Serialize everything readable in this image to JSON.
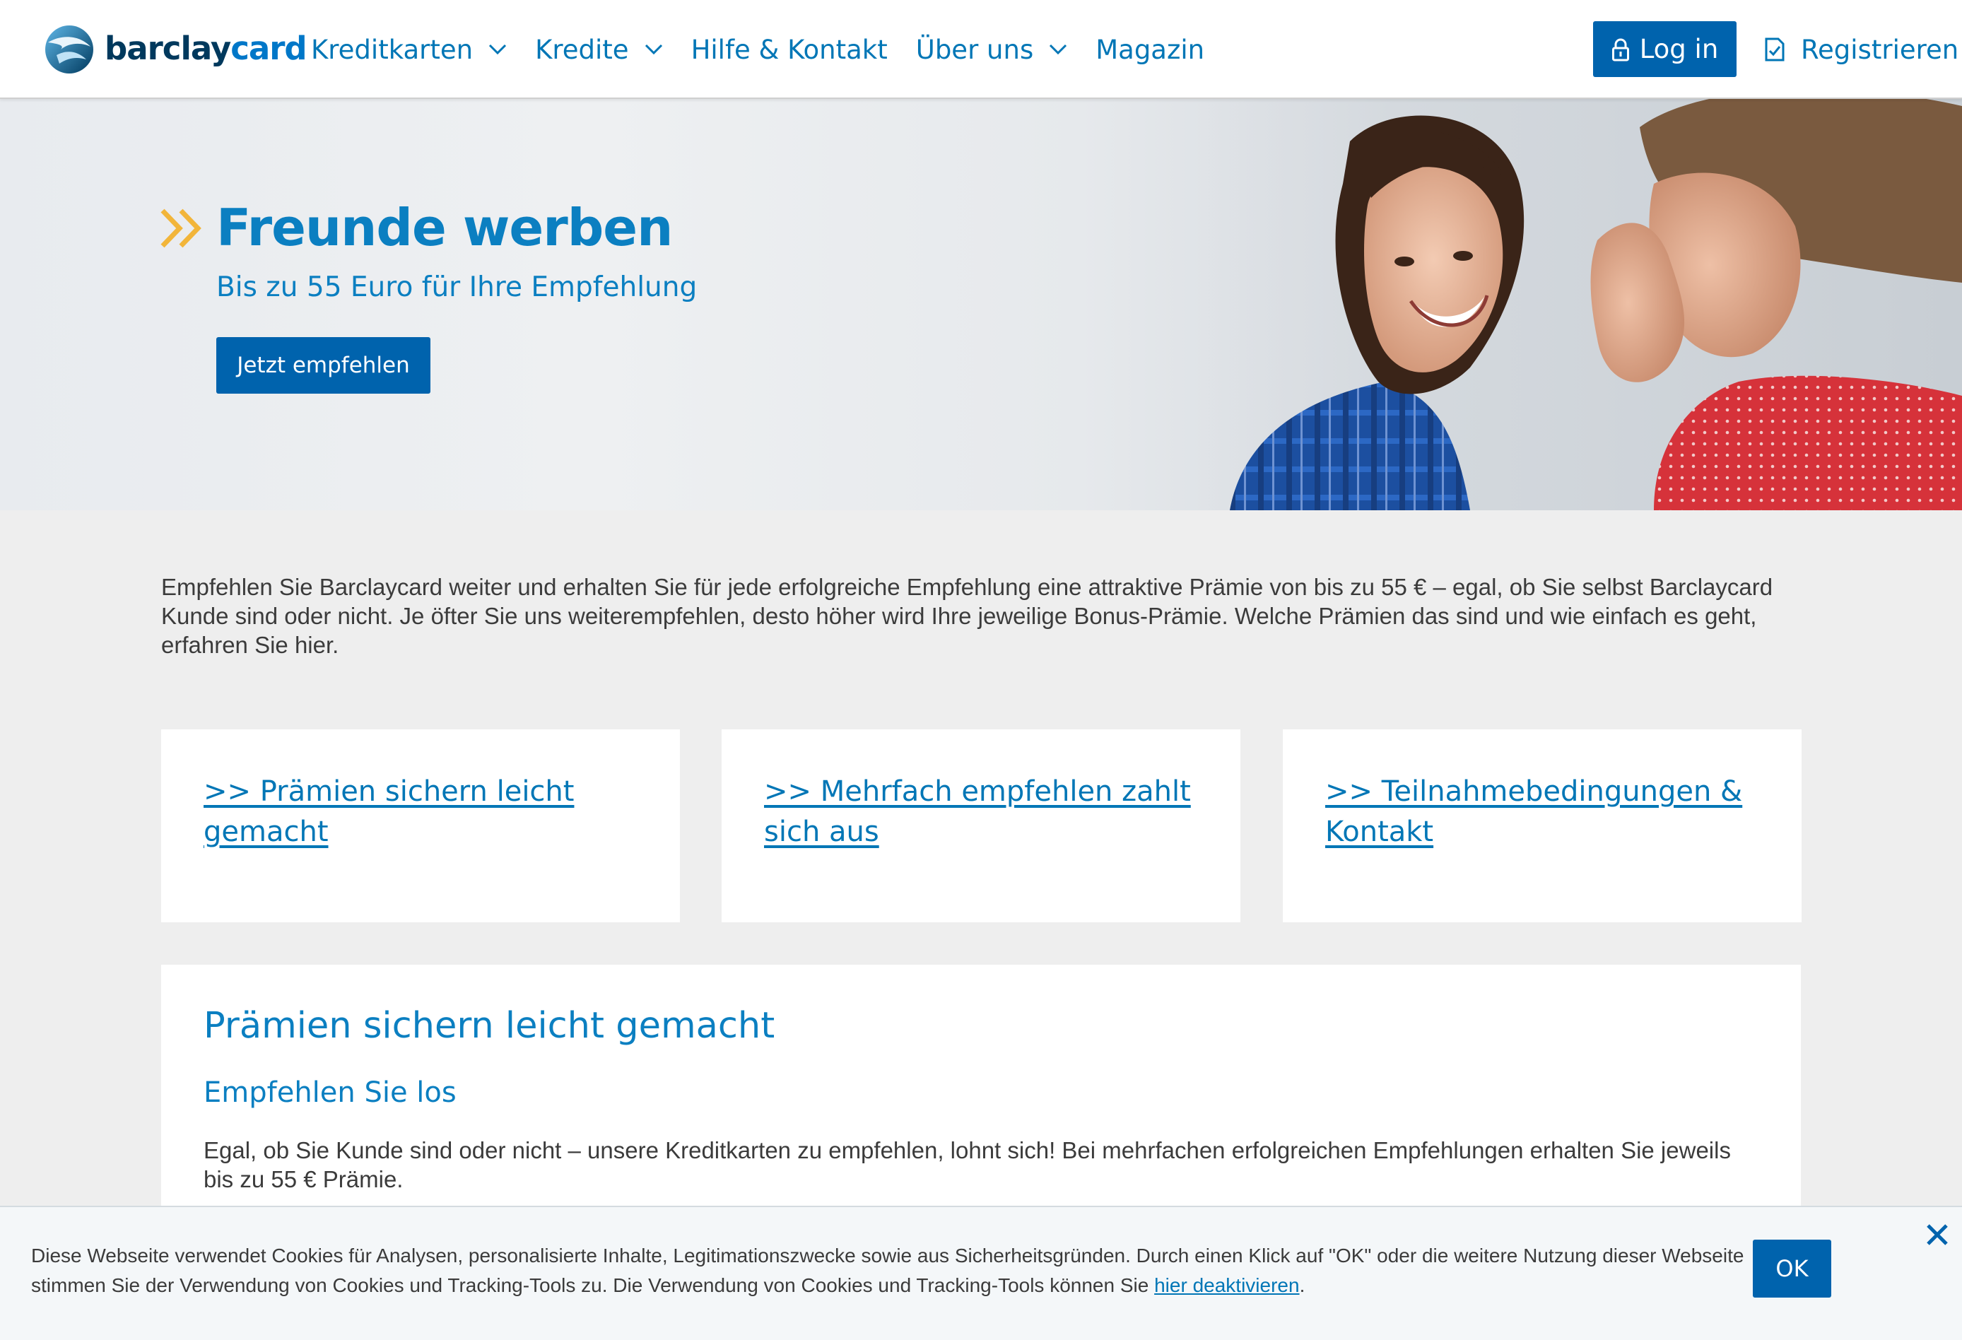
{
  "brand": {
    "name_part1": "barclay",
    "name_part2": "card"
  },
  "nav": {
    "items": [
      {
        "label": "Kreditkarten",
        "has_dropdown": true
      },
      {
        "label": "Kredite",
        "has_dropdown": true
      },
      {
        "label": "Hilfe & Kontakt",
        "has_dropdown": false
      },
      {
        "label": "Über uns",
        "has_dropdown": true
      },
      {
        "label": "Magazin",
        "has_dropdown": false
      }
    ],
    "login_label": "Log in",
    "register_label": "Registrieren"
  },
  "hero": {
    "title": "Freunde werben",
    "subtitle": "Bis zu 55 Euro für Ihre Empfehlung",
    "cta_label": "Jetzt empfehlen"
  },
  "intro": {
    "text": "Empfehlen Sie Barclaycard weiter und erhalten Sie für jede erfolgreiche Empfehlung eine attraktive Prämie von bis zu 55 € – egal, ob Sie selbst Barclaycard Kunde sind oder nicht. Je öfter Sie uns weiterempfehlen, desto höher wird Ihre jeweilige Bonus-Prämie. Welche Prämien das sind und wie einfach es geht, erfahren Sie hier."
  },
  "cards": [
    {
      "label": ">> Prämien sichern leicht gemacht"
    },
    {
      "label": ">> Mehrfach empfehlen zahlt sich aus"
    },
    {
      "label": ">> Teilnahmebedingungen & Kontakt"
    }
  ],
  "section": {
    "title": "Prämien sichern leicht gemacht",
    "subtitle": "Empfehlen Sie los",
    "text": "Egal, ob Sie Kunde sind oder nicht – unsere Kreditkarten zu empfehlen, lohnt sich! Bei mehrfachen erfolgreichen Empfehlungen erhalten Sie jeweils bis zu 55 € Prämie."
  },
  "cookie": {
    "text_before": "Diese Webseite verwendet Cookies für Analysen, personalisierte Inhalte, Legitimationszwecke sowie aus Sicherheitsgründen. Durch einen Klick auf \"OK\" oder die weitere Nutzung dieser Webseite stimmen Sie der Verwendung von Cookies und Tracking-Tools zu. Die Verwendung von Cookies und Tracking-Tools können Sie ",
    "link_label": "hier deaktivieren",
    "text_after": ".",
    "ok_label": "OK"
  },
  "icons": {
    "logo": "eagle-logo-icon",
    "dropdown": "chevron-down-icon",
    "login": "lock-icon",
    "register": "document-check-icon",
    "hero_marker": "double-chevron-right-icon",
    "close": "close-icon"
  },
  "colors": {
    "primary_button": "#0063ad",
    "link_blue": "#0076b6",
    "heading_blue": "#0b7fc1",
    "accent_yellow": "#f2b53a",
    "page_background": "#eeeeee"
  }
}
